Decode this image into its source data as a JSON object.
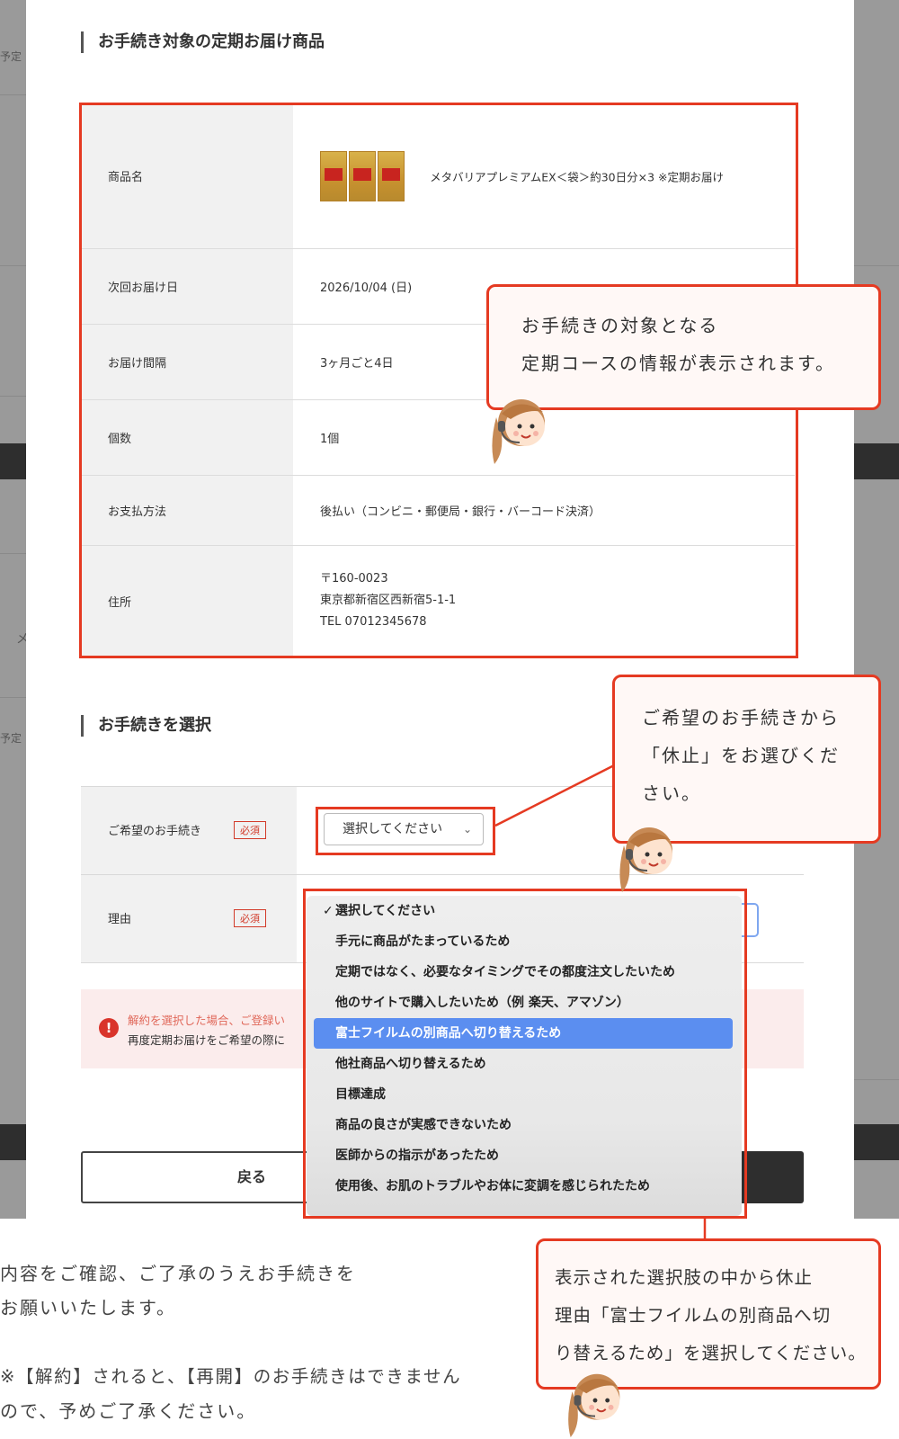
{
  "page": {
    "side_text_1": "予定",
    "side_text_2": "予定",
    "side_text_3": "メ"
  },
  "section1": {
    "title": "お手続き対象の定期お届け商品"
  },
  "info": {
    "rows": [
      {
        "label": "商品名",
        "value": "メタバリアプレミアムEX＜袋＞約30日分×3 ※定期お届け"
      },
      {
        "label": "次回お届け日",
        "value": "2026/10/04 (日)"
      },
      {
        "label": "お届け間隔",
        "value": "3ヶ月ごと4日"
      },
      {
        "label": "個数",
        "value": "1個"
      },
      {
        "label": "お支払方法",
        "value": "後払い（コンビニ・郵便局・銀行・バーコード決済）"
      },
      {
        "label": "住所",
        "postal": "〒160-0023",
        "address": "東京都新宿区西新宿5-1-1",
        "tel": "TEL 07012345678"
      }
    ]
  },
  "section2": {
    "title": "お手続きを選択"
  },
  "form": {
    "procedure_label": "ご希望のお手続き",
    "reason_label": "理由",
    "required_badge": "必須",
    "select_value": "選択してください"
  },
  "alert": {
    "line1": "解約を選択した場合、ご登録い",
    "line2": "再度定期お届けをご希望の際に"
  },
  "buttons": {
    "back": "戻る"
  },
  "dropdown": {
    "options": [
      "選択してください",
      "手元に商品がたまっているため",
      "定期ではなく、必要なタイミングでその都度注文したいため",
      "他のサイトで購入したいため（例 楽天、アマゾン）",
      "富士フイルムの別商品へ切り替えるため",
      "他社商品へ切り替えるため",
      "目標達成",
      "商品の良さが実感できないため",
      "医師からの指示があったため",
      "使用後、お肌のトラブルやお体に変調を感じられたため"
    ],
    "checked_index": 0,
    "highlight_index": 4
  },
  "callouts": {
    "c1_line1": "お手続きの対象となる",
    "c1_line2": "定期コースの情報が表示されます。",
    "c2_line1": "ご希望のお手続きから",
    "c2_line2": "「休止」をお選びくだ",
    "c2_line3": "さい。",
    "c3_line1": "表示された選択肢の中から休止",
    "c3_line2": "理由「富士フイルムの別商品へ切",
    "c3_line3": "り替えるため」を選択してください。"
  },
  "bottom": {
    "line1": "内容をご確認、ご了承のうえお手続きを",
    "line2": "お願いいたします。",
    "line3": "※【解約】されると、【再開】のお手続きはできません",
    "line4": "ので、予めご了承ください。"
  },
  "colors": {
    "accent": "#e53a22",
    "highlight": "#5b8ef0"
  }
}
